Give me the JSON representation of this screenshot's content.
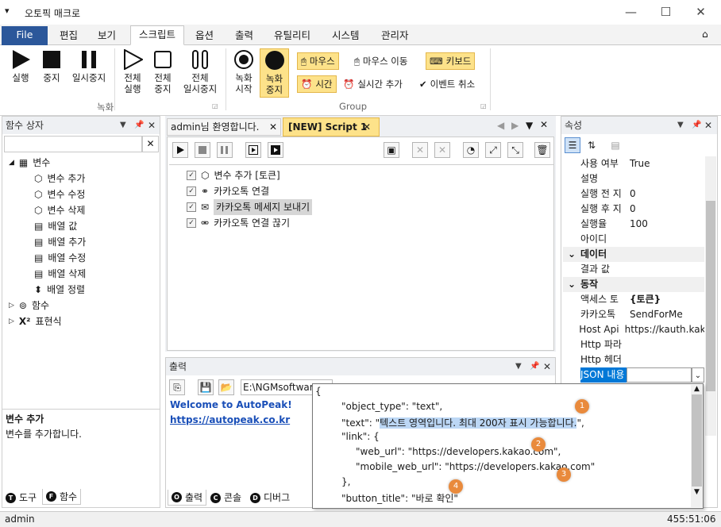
{
  "app": {
    "title": "오토픽 매크로"
  },
  "menu": {
    "tabs": [
      "File",
      "편집",
      "보기",
      "스크립트",
      "옵션",
      "출력",
      "유틸리티",
      "시스템",
      "관리자"
    ],
    "active_index": 3
  },
  "ribbon": {
    "run": "실행",
    "stop": "중지",
    "pause": "일시중지",
    "all_run": [
      "전체",
      "실행"
    ],
    "all_stop": [
      "전체",
      "중지"
    ],
    "all_pause": [
      "전체",
      "일시중지"
    ],
    "rec_start": [
      "녹화",
      "시작"
    ],
    "rec_stop": [
      "녹화",
      "중지"
    ],
    "group_record": "녹화",
    "mouse_click": "마우스",
    "mouse_move": "마우스 이동",
    "keyboard": "키보드",
    "time": "시간",
    "realtime_add": "실시간 추가",
    "event_cancel": "이벤트 취소",
    "group_group": "Group"
  },
  "function_box": {
    "title": "함수 상자",
    "search_value": "",
    "tree": {
      "variables": "변수",
      "items": [
        "변수 추가",
        "변수 수정",
        "변수 삭제",
        "배열 값",
        "배열 추가",
        "배열 수정",
        "배열 삭제",
        "배열 정렬"
      ],
      "functions": "함수",
      "expressions": "표현식"
    },
    "desc_title": "변수 추가",
    "desc_text": "변수를 추가합니다.",
    "tabs": [
      "도구",
      "함수"
    ]
  },
  "editor": {
    "tabs": [
      "admin님 환영합니다.",
      "[NEW] Script 1"
    ],
    "script_lines": [
      "변수 추가 [토큰]",
      "카카오톡 연결",
      "카카오톡 메세지 보내기",
      "카카오톡 연결 끊기"
    ],
    "selected_line": 2
  },
  "output": {
    "title": "출력",
    "path_value": "E:\\NGMsoftware\\",
    "welcome": "Welcome to AutoPeak!",
    "link": "https://autopeak.co.kr",
    "tabs": [
      "출력",
      "콘솔",
      "디버그"
    ]
  },
  "properties": {
    "title": "속성",
    "rows": [
      {
        "k": "사용 여부",
        "v": "True"
      },
      {
        "k": "설명",
        "v": ""
      },
      {
        "k": "실행 전 지",
        "v": "0"
      },
      {
        "k": "실행 후 지",
        "v": "0"
      },
      {
        "k": "실행율",
        "v": "100"
      },
      {
        "k": "아이디",
        "v": ""
      }
    ],
    "cat_data": "데이터",
    "data_rows": [
      {
        "k": "결과 값",
        "v": ""
      }
    ],
    "cat_action": "동작",
    "action_rows": [
      {
        "k": "액세스 토",
        "v": "{토큰}"
      },
      {
        "k": "카카오톡",
        "v": "SendForMe"
      },
      {
        "k": "Host Api A",
        "v": "https://kauth.kaka"
      },
      {
        "k": "Http 파라",
        "v": ""
      },
      {
        "k": "Http 헤더",
        "v": ""
      }
    ],
    "json_row_key": "JSON 내용"
  },
  "json_popup": {
    "lines": [
      "{",
      "\"object_type\": \"text\",",
      "\"text\": \"",
      "\"link\": {",
      "\"web_url\": \"https://developers.kakao.com\",",
      "\"mobile_web_url\": \"https://developers.kakao.com\"",
      "},",
      "\"button_title\": \"바로 확인\"",
      "}"
    ],
    "highlight": "텍스트 영역입니다. 최대 200자 표시 가능합니다.",
    "text_end": "\",",
    "badges": [
      "1",
      "2",
      "3",
      "4"
    ]
  },
  "status": {
    "user": "admin",
    "time": "455:51:06"
  },
  "colors": {
    "accent": "#2b579a",
    "highlight": "#fde28a",
    "badge": "#e98a3c",
    "json_sel": "#bcd7f5"
  }
}
